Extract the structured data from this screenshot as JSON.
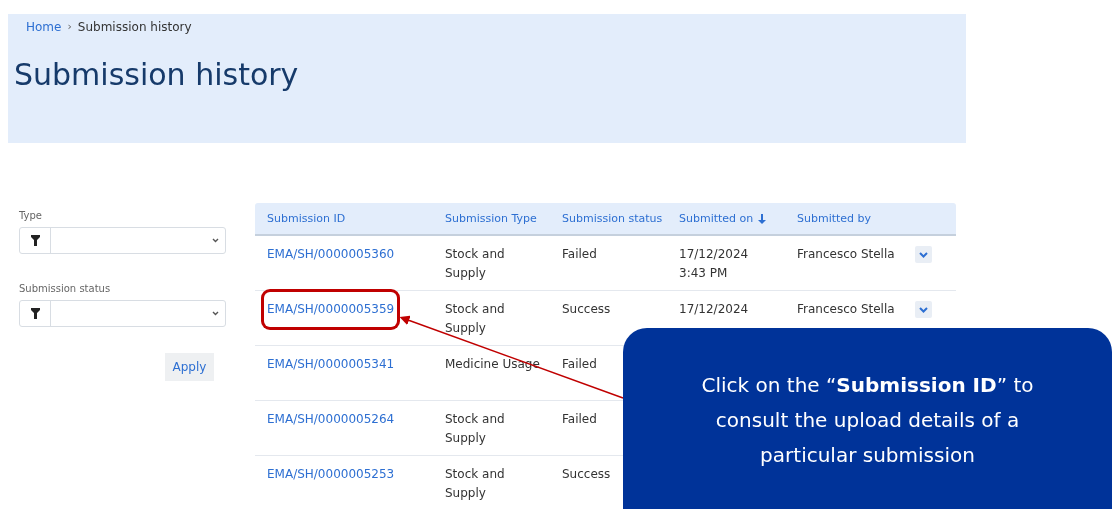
{
  "breadcrumb": [
    {
      "label": "Home",
      "link": true
    },
    {
      "label": "Submission history",
      "link": false
    }
  ],
  "breadcrumb_separator": "›",
  "title": "Submission history",
  "filters": [
    {
      "label": "Type"
    },
    {
      "label": "Submission status"
    }
  ],
  "apply_button": "Apply",
  "table": {
    "columns": [
      {
        "label": "Submission ID",
        "sorted": false
      },
      {
        "label": "Submission Type",
        "sorted": false
      },
      {
        "label": "Submission status",
        "sorted": false
      },
      {
        "label": "Submitted on",
        "sorted": true
      },
      {
        "label": "Submitted by",
        "sorted": false
      }
    ],
    "rows": [
      {
        "id": "EMA/SH/0000005360",
        "type": "Stock and Supply",
        "status": "Failed",
        "date": "17/12/2024",
        "time": "3:43 PM",
        "by": "Francesco Stella",
        "highlighted": false
      },
      {
        "id": "EMA/SH/0000005359",
        "type": "Stock and Supply",
        "status": "Success",
        "date": "17/12/2024",
        "by": "Francesco Stella",
        "highlighted": true
      },
      {
        "id": "EMA/SH/0000005341",
        "type": "Medicine Usage",
        "status": "Failed",
        "highlighted": false
      },
      {
        "id": "EMA/SH/0000005264",
        "type": "Stock and Supply",
        "status": "Failed",
        "highlighted": false
      },
      {
        "id": "EMA/SH/0000005253",
        "type": "Stock and Supply",
        "status": "Success",
        "highlighted": false
      }
    ]
  },
  "callout": {
    "text": "Click on the “**Submission ID**” to consult the upload details of a particular submission"
  }
}
